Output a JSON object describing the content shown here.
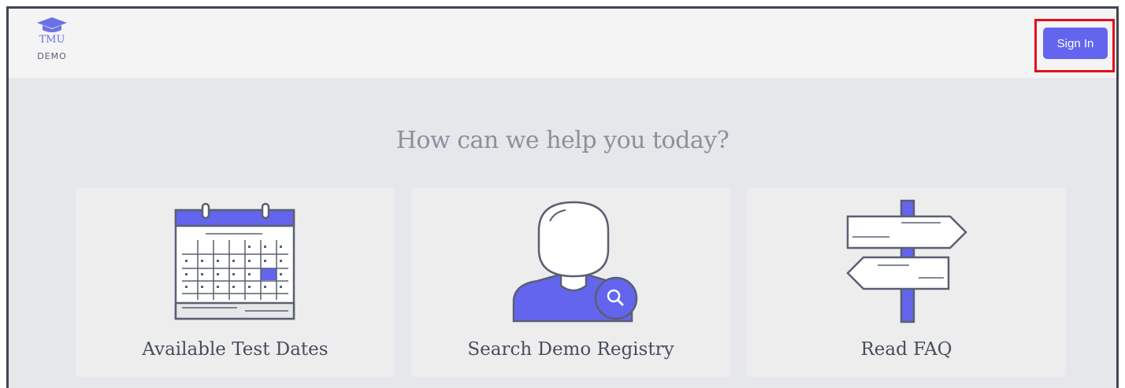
{
  "header": {
    "logo_text": "TMU",
    "logo_sub": "DEMO",
    "signin_label": "Sign In"
  },
  "main": {
    "headline": "How can we help you today?",
    "cards": [
      {
        "label": "Available Test Dates",
        "icon": "calendar-icon"
      },
      {
        "label": "Search Demo Registry",
        "icon": "user-search-icon"
      },
      {
        "label": "Read FAQ",
        "icon": "signpost-icon"
      }
    ]
  },
  "colors": {
    "accent": "#6365ee",
    "highlight": "#e0101a",
    "outline": "#5a6070"
  }
}
